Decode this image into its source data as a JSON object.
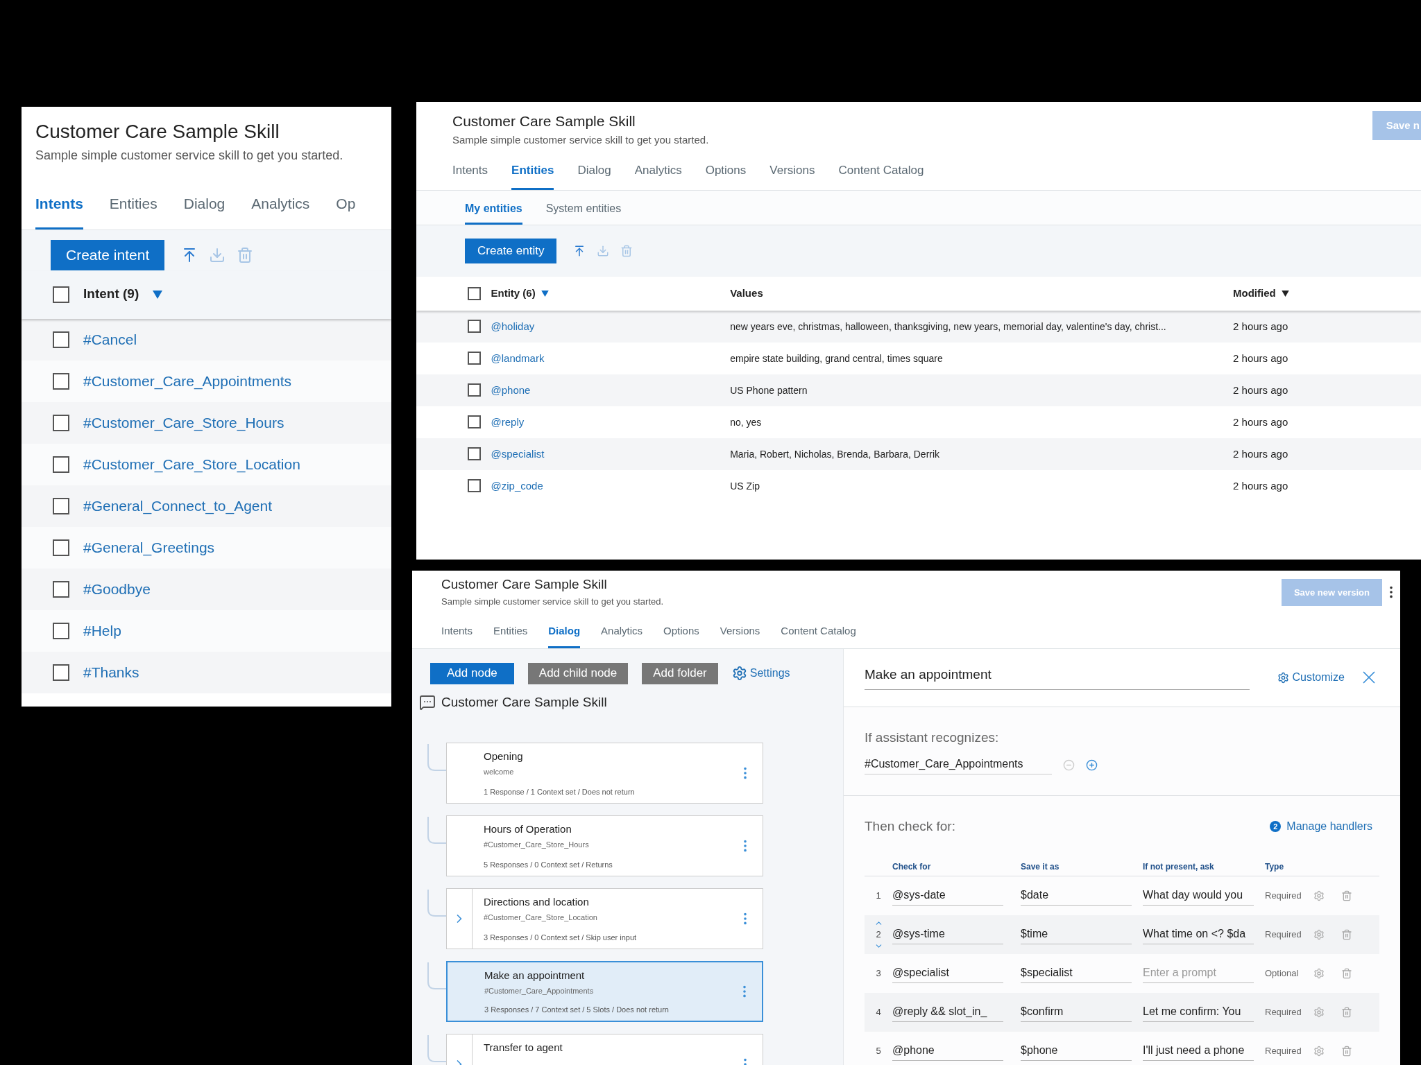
{
  "intents_panel": {
    "title": "Customer Care Sample Skill",
    "subtitle": "Sample simple customer service skill to get you started.",
    "tabs": [
      {
        "label": "Intents",
        "selected": true
      },
      {
        "label": "Entities",
        "selected": false
      },
      {
        "label": "Dialog",
        "selected": false
      },
      {
        "label": "Analytics",
        "selected": false
      },
      {
        "label": "Op",
        "selected": false
      }
    ],
    "create_button": "Create intent",
    "header": {
      "label": "Intent (9)",
      "checked": false
    },
    "rows": [
      {
        "name": "#Cancel",
        "checked": false
      },
      {
        "name": "#Customer_Care_Appointments",
        "checked": false
      },
      {
        "name": "#Customer_Care_Store_Hours",
        "checked": false
      },
      {
        "name": "#Customer_Care_Store_Location",
        "checked": false
      },
      {
        "name": "#General_Connect_to_Agent",
        "checked": false
      },
      {
        "name": "#General_Greetings",
        "checked": false
      },
      {
        "name": "#Goodbye",
        "checked": false
      },
      {
        "name": "#Help",
        "checked": false
      },
      {
        "name": "#Thanks",
        "checked": false
      }
    ]
  },
  "entities_panel": {
    "title": "Customer Care Sample Skill",
    "subtitle": "Sample simple customer service skill to get you started.",
    "save_button": "Save n",
    "tabs": [
      {
        "label": "Intents",
        "selected": false
      },
      {
        "label": "Entities",
        "selected": true
      },
      {
        "label": "Dialog",
        "selected": false
      },
      {
        "label": "Analytics",
        "selected": false
      },
      {
        "label": "Options",
        "selected": false
      },
      {
        "label": "Versions",
        "selected": false
      },
      {
        "label": "Content Catalog",
        "selected": false
      }
    ],
    "subtabs": [
      {
        "label": "My entities",
        "selected": true
      },
      {
        "label": "System entities",
        "selected": false
      }
    ],
    "create_button": "Create entity",
    "header_checked": false,
    "columns": [
      {
        "label": "Entity (6)",
        "sorted": true
      },
      {
        "label": "Values",
        "sorted": false
      },
      {
        "label": "Modified",
        "sorted": true
      }
    ],
    "rows": [
      {
        "name": "@holiday",
        "values": "new years eve, christmas, halloween, thanksgiving, new years, memorial day, valentine's day, christ...",
        "modified": "2 hours ago",
        "checked": false
      },
      {
        "name": "@landmark",
        "values": "empire state building, grand central, times square",
        "modified": "2 hours ago",
        "checked": false
      },
      {
        "name": "@phone",
        "values": "US Phone pattern",
        "modified": "2 hours ago",
        "checked": false
      },
      {
        "name": "@reply",
        "values": "no, yes",
        "modified": "2 hours ago",
        "checked": false
      },
      {
        "name": "@specialist",
        "values": "Maria, Robert, Nicholas, Brenda, Barbara, Derrik",
        "modified": "2 hours ago",
        "checked": false
      },
      {
        "name": "@zip_code",
        "values": "US Zip",
        "modified": "2 hours ago",
        "checked": false
      }
    ]
  },
  "dialog_panel": {
    "title": "Customer Care Sample Skill",
    "subtitle": "Sample simple customer service skill to get you started.",
    "save_button": "Save new version",
    "tabs": [
      {
        "label": "Intents",
        "selected": false
      },
      {
        "label": "Entities",
        "selected": false
      },
      {
        "label": "Dialog",
        "selected": true
      },
      {
        "label": "Analytics",
        "selected": false
      },
      {
        "label": "Options",
        "selected": false
      },
      {
        "label": "Versions",
        "selected": false
      },
      {
        "label": "Content Catalog",
        "selected": false
      }
    ],
    "toolbar": [
      {
        "label": "Add node",
        "kind": "primary"
      },
      {
        "label": "Add child node",
        "kind": "secondary"
      },
      {
        "label": "Add folder",
        "kind": "secondary"
      },
      {
        "label": "Settings",
        "kind": "link"
      }
    ],
    "root": "Customer Care Sample Skill",
    "nodes": [
      {
        "title": "Opening",
        "condition": "welcome",
        "summary": "1 Response / 1 Context set / Does not return",
        "selected": false,
        "expandable": false
      },
      {
        "title": "Hours of Operation",
        "condition": "#Customer_Care_Store_Hours",
        "summary": "5 Responses / 0 Context set / Returns",
        "selected": false,
        "expandable": false
      },
      {
        "title": "Directions and location",
        "condition": "#Customer_Care_Store_Location",
        "summary": "3 Responses / 0 Context set / Skip user input",
        "selected": false,
        "expandable": true
      },
      {
        "title": "Make an appointment",
        "condition": "#Customer_Care_Appointments",
        "summary": "3 Responses / 7 Context set / 5 Slots / Does not return",
        "selected": true,
        "expandable": false
      },
      {
        "title": "Transfer to agent",
        "selected": false,
        "expandable": true
      }
    ],
    "editor": {
      "node_name": "Make an appointment",
      "customize": "Customize",
      "recognizes_label": "If assistant recognizes:",
      "condition": "#Customer_Care_Appointments",
      "check_label": "Then check for:",
      "handlers_count": "2",
      "handlers_link": "Manage handlers",
      "columns": [
        "Check for",
        "Save it as",
        "If not present, ask",
        "Type"
      ],
      "slots": [
        {
          "number": "1",
          "check": "@sys-date",
          "save": "$date",
          "prompt": "What day would you",
          "type": "Required",
          "reorder": false
        },
        {
          "number": "2",
          "check": "@sys-time",
          "save": "$time",
          "prompt": "What time on <? $da",
          "type": "Required",
          "reorder": true
        },
        {
          "number": "3",
          "check": "@specialist",
          "save": "$specialist",
          "placeholder": "Enter a prompt",
          "type": "Optional",
          "reorder": false
        },
        {
          "number": "4",
          "check": "@reply && slot_in_",
          "save": "$confirm",
          "prompt": "Let me confirm: You",
          "type": "Required",
          "reorder": false
        },
        {
          "number": "5",
          "check": "@phone",
          "save": "$phone",
          "prompt": "I'll just need a phone",
          "type": "Required",
          "reorder": false
        }
      ]
    }
  }
}
